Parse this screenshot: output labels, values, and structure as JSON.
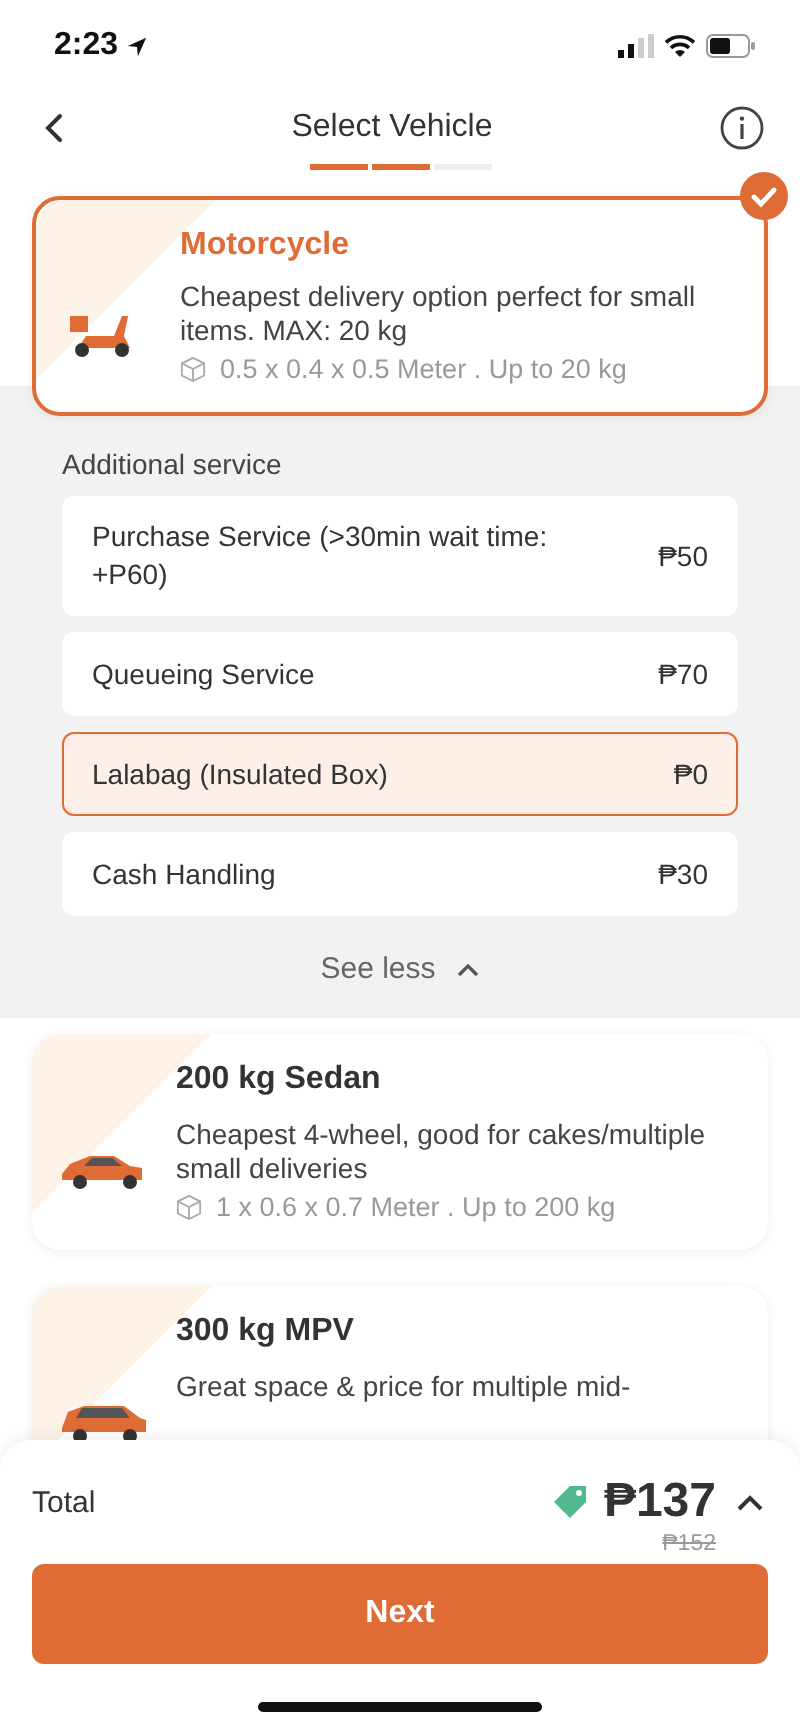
{
  "status_bar": {
    "time": "2:23"
  },
  "header": {
    "title": "Select Vehicle"
  },
  "steps": [
    {
      "done": true
    },
    {
      "done": true
    },
    {
      "done": false
    }
  ],
  "vehicles": [
    {
      "kind": "scooter",
      "name": "Motorcycle",
      "selected": true,
      "description": "Cheapest delivery option perfect for small items. MAX: 20 kg",
      "size": "0.5 x 0.4 x 0.5 Meter . Up to 20 kg"
    },
    {
      "kind": "sedan",
      "name": "200 kg Sedan",
      "selected": false,
      "description": "Cheapest 4-wheel, good for cakes/multiple small deliveries",
      "size": "1 x 0.6 x 0.7 Meter . Up to 200 kg"
    },
    {
      "kind": "mpv",
      "name": "300 kg MPV",
      "selected": false,
      "description": "Great space & price for multiple mid-"
    }
  ],
  "additional_service": {
    "label": "Additional service",
    "items": [
      {
        "name": "Purchase Service (>30min wait time: +P60)",
        "price": "₱50",
        "selected": false
      },
      {
        "name": "Queueing Service",
        "price": "₱70",
        "selected": false
      },
      {
        "name": "Lalabag (Insulated Box)",
        "price": "₱0",
        "selected": true
      },
      {
        "name": "Cash Handling",
        "price": "₱30",
        "selected": false
      }
    ],
    "toggle": {
      "label": "See less",
      "expanded": true
    }
  },
  "footer": {
    "total_label": "Total",
    "total": "₱137",
    "original_price": "₱152",
    "button": "Next"
  }
}
